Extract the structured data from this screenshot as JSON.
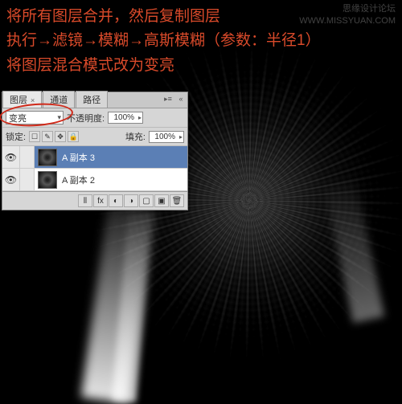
{
  "watermark": {
    "line1": "思缘设计论坛",
    "line2": "WWW.MISSYUAN.COM"
  },
  "instructions": {
    "line1": "将所有图层合并，然后复制图层",
    "line2": "执行→滤镜→模糊→高斯模糊（参数：半径1）",
    "line3": "将图层混合模式改为变亮"
  },
  "panel": {
    "tabs": {
      "layers": "图层",
      "channels": "通道",
      "paths": "路径"
    },
    "blend_mode": "变亮",
    "opacity_label": "不透明度:",
    "opacity_value": "100%",
    "lock_label": "锁定:",
    "fill_label": "填充:",
    "fill_value": "100%",
    "layers_list": [
      {
        "name": "A 副本 3"
      },
      {
        "name": "A 副本 2"
      }
    ],
    "icons": {
      "eye": "👁",
      "lock_all": "☐",
      "lock_px": "✎",
      "lock_pos": "✥",
      "lock_lock": "🔒",
      "fx": "fx",
      "mask": "◐",
      "folder": "▢",
      "adjust": "◑",
      "new": "▣",
      "trash": "🗑",
      "link": "⦀"
    }
  }
}
